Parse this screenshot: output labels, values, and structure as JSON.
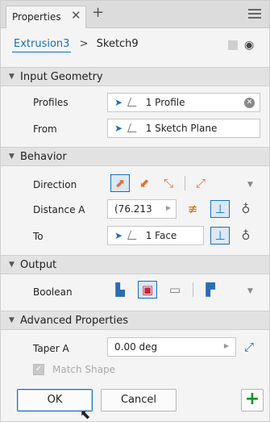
{
  "tab": {
    "title": "Properties",
    "close": "✕",
    "add": "+"
  },
  "breadcrumb": {
    "feature": "Extrusion3",
    "separator": ">",
    "sketch": "Sketch9"
  },
  "sections": {
    "input_geometry": "Input Geometry",
    "behavior": "Behavior",
    "output": "Output",
    "advanced": "Advanced Properties"
  },
  "input_geometry": {
    "profiles_label": "Profiles",
    "profiles_value": "1 Profile",
    "from_label": "From",
    "from_value": "1 Sketch Plane"
  },
  "behavior": {
    "direction_label": "Direction",
    "distance_label": "Distance A",
    "distance_value": "(76.213",
    "to_label": "To",
    "to_value": "1 Face"
  },
  "output": {
    "boolean_label": "Boolean"
  },
  "advanced": {
    "taper_label": "Taper A",
    "taper_value": "0.00 deg",
    "match_shape_label": "Match Shape"
  },
  "footer": {
    "ok_label": "OK",
    "cancel_label": "Cancel",
    "plus": "+"
  },
  "colors": {
    "accent": "#1a6fb5",
    "add_green": "#1a8f2a",
    "direction_orange": "#e0703a"
  },
  "icons": [
    "close-icon",
    "plus-icon",
    "hamburger-icon",
    "eye-icon",
    "select-cursor-icon",
    "profile-icon",
    "sketch-plane-icon",
    "clear-icon",
    "direction-icon",
    "flip-icon",
    "symmetric-icon",
    "asymmetric-icon",
    "distance-icon",
    "to-icon",
    "join-icon",
    "cut-icon",
    "intersect-icon",
    "new-solid-icon",
    "taper-flip-icon",
    "mouse-cursor-icon"
  ]
}
